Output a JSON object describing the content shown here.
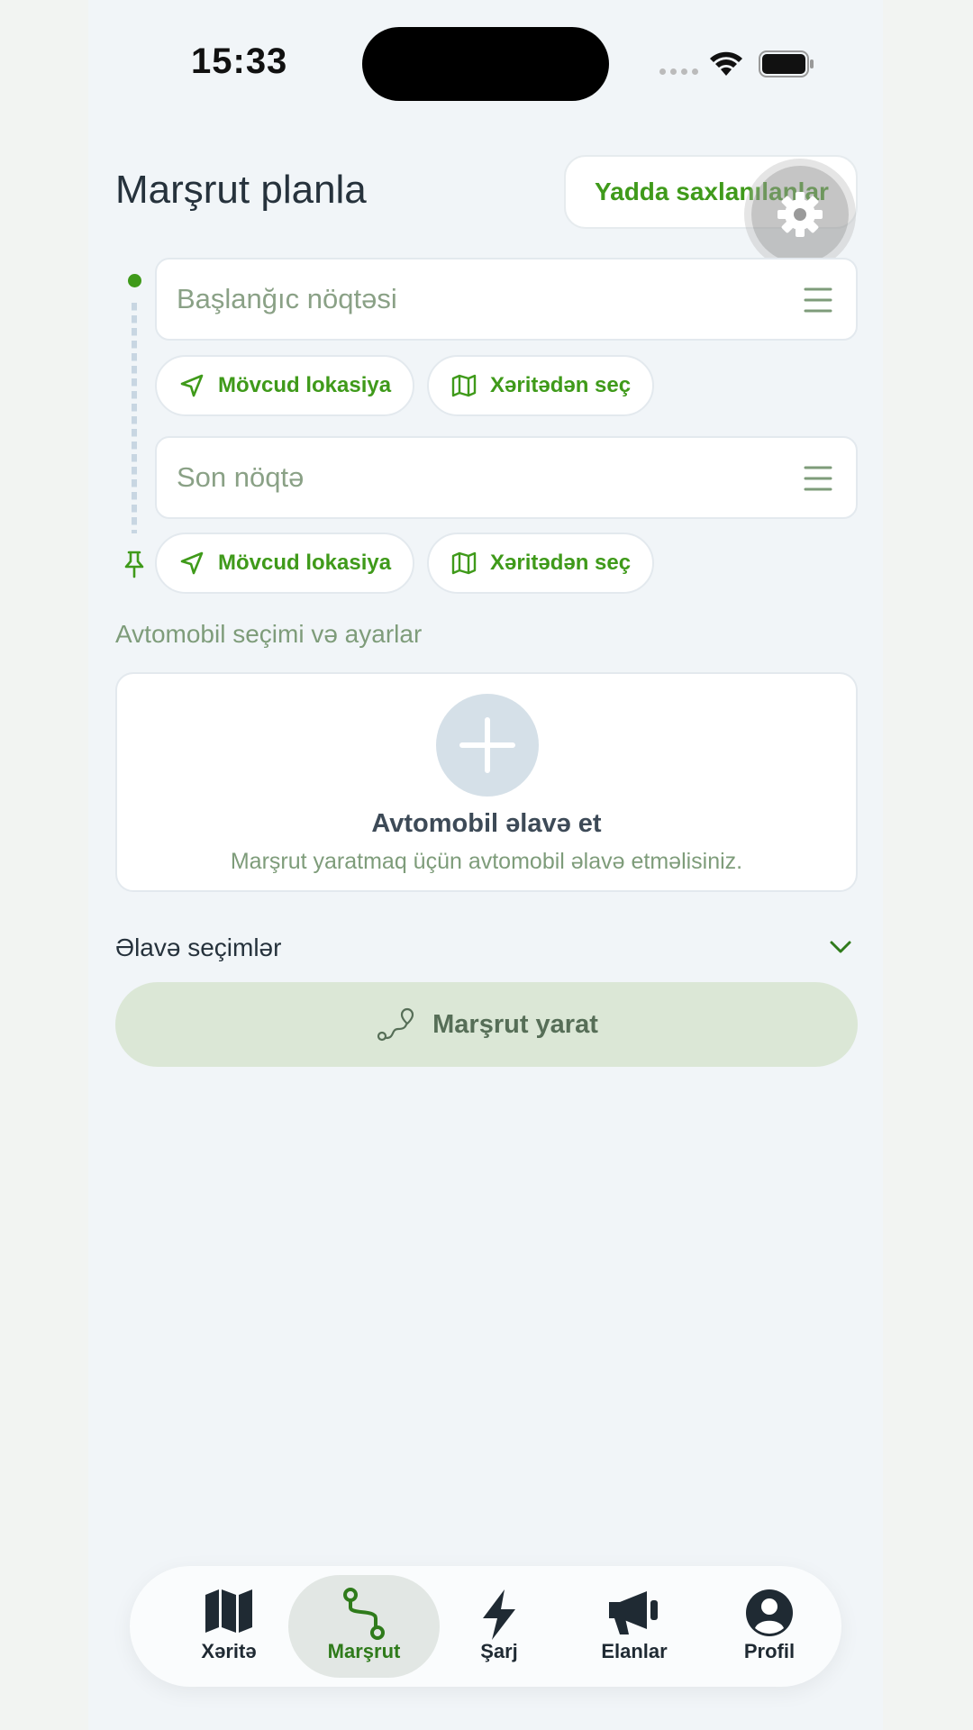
{
  "status_bar": {
    "time": "15:33"
  },
  "header": {
    "title": "Marşrut planla",
    "saved_label": "Yadda saxlanılanlar"
  },
  "start_point": {
    "placeholder": "Başlanğıc nöqtəsi",
    "current_location_label": "Mövcud lokasiya",
    "pick_on_map_label": "Xəritədən seç"
  },
  "end_point": {
    "placeholder": "Son nöqtə",
    "current_location_label": "Mövcud lokasiya",
    "pick_on_map_label": "Xəritədən seç"
  },
  "vehicle": {
    "section_label": "Avtomobil seçimi və ayarlar",
    "add_title": "Avtomobil əlavə et",
    "add_subtitle": "Marşrut yaratmaq üçün avtomobil əlavə etməlisiniz."
  },
  "extra_options": {
    "label": "Əlavə seçimlər"
  },
  "create_route": {
    "label": "Marşrut yarat"
  },
  "tabbar": {
    "items": [
      {
        "label": "Xəritə",
        "icon": "map-icon",
        "active": false
      },
      {
        "label": "Marşrut",
        "icon": "route-icon",
        "active": true
      },
      {
        "label": "Şarj",
        "icon": "bolt-icon",
        "active": false
      },
      {
        "label": "Elanlar",
        "icon": "megaphone-icon",
        "active": false
      },
      {
        "label": "Profil",
        "icon": "user-icon",
        "active": false
      }
    ]
  },
  "colors": {
    "accent": "#3f9a1a",
    "background": "#f1f5f8",
    "button_disabled": "#dbe7d6"
  }
}
